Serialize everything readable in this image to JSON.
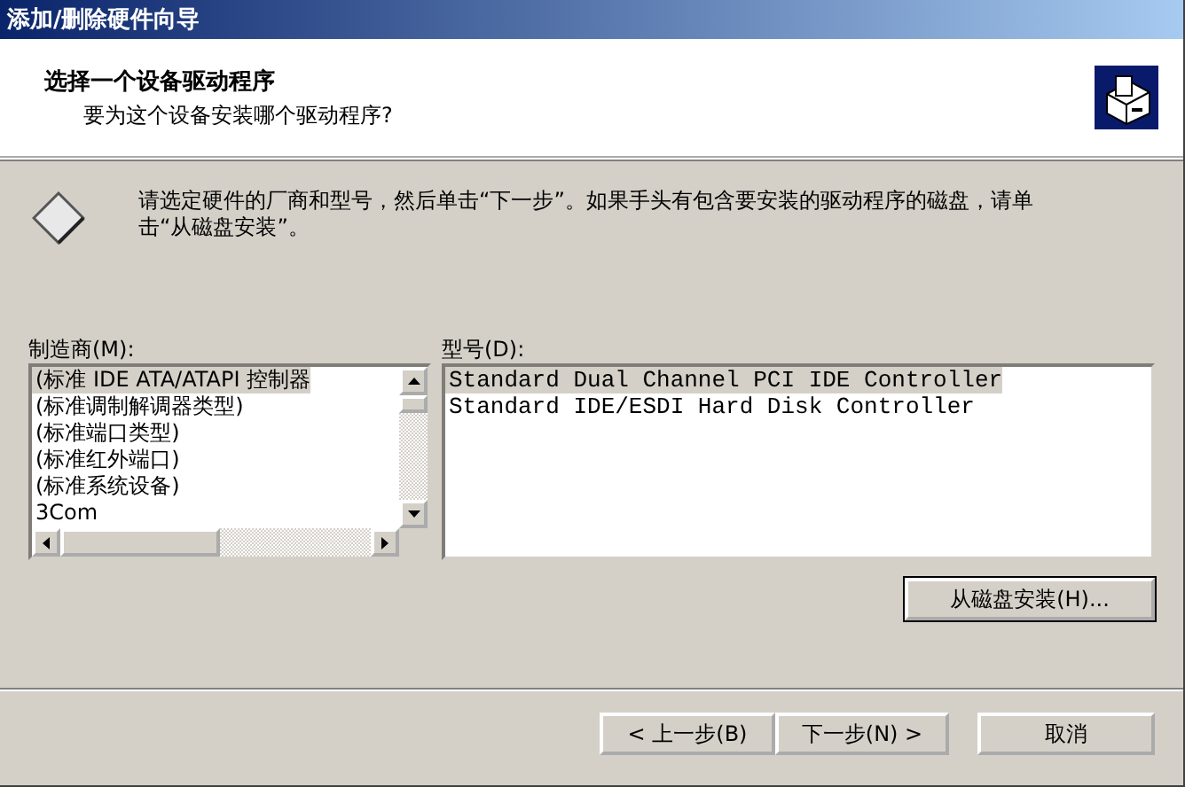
{
  "window": {
    "title": "添加/删除硬件向导"
  },
  "header": {
    "title": "选择一个设备驱动程序",
    "subtitle": "要为这个设备安装哪个驱动程序?"
  },
  "instruction": "请选定硬件的厂商和型号，然后单击“下一步”。如果手头有包含要安装的驱动程序的磁盘，请单击“从磁盘安装”。",
  "manufacturers": {
    "label": "制造商(M):",
    "items": [
      {
        "text": "(标准 IDE ATA/ATAPI 控制器",
        "selected": true
      },
      {
        "text": "(标准调制解调器类型)",
        "selected": false
      },
      {
        "text": "(标准端口类型)",
        "selected": false
      },
      {
        "text": "(标准红外端口)",
        "selected": false
      },
      {
        "text": "(标准系统设备)",
        "selected": false
      },
      {
        "text": "3Com",
        "selected": false
      }
    ]
  },
  "models": {
    "label": "型号(D):",
    "items": [
      {
        "text": "Standard Dual Channel PCI IDE Controller",
        "selected": true
      },
      {
        "text": "Standard IDE/ESDI Hard Disk Controller",
        "selected": false
      }
    ]
  },
  "have_disk_button": "从磁盘安装(H)...",
  "buttons": [
    {
      "label": "< 上一步(B)",
      "kind": "back"
    },
    {
      "label": "下一步(N) >",
      "kind": "next"
    },
    {
      "label": "取消",
      "kind": "cancel"
    }
  ]
}
